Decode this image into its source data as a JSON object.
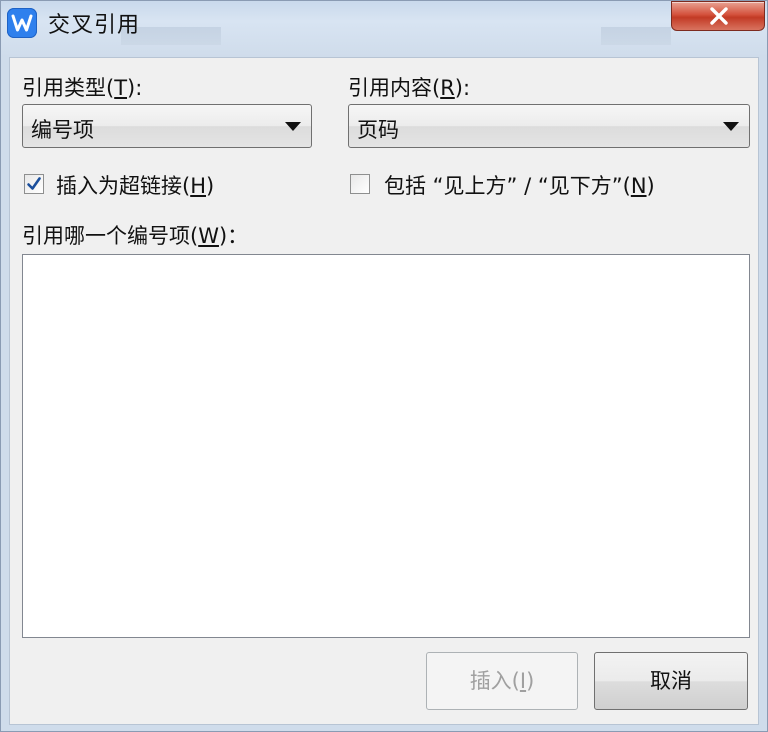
{
  "window": {
    "title": "交叉引用",
    "close_symbol": "✕"
  },
  "ref_type": {
    "label": "引用类型(",
    "mnemonic": "T",
    "label_end": "):",
    "selected": "编号项"
  },
  "ref_content": {
    "label": "引用内容(",
    "mnemonic": "R",
    "label_end": "):",
    "selected": "页码"
  },
  "hyperlink_option": {
    "label": "插入为超链接(",
    "mnemonic": "H",
    "label_end": ")",
    "checked": true
  },
  "above_below_option": {
    "label": "包括 “见上方” / “见下方”(",
    "mnemonic": "N",
    "label_end": ")",
    "checked": false
  },
  "which_item": {
    "label": "引用哪一个编号项(",
    "mnemonic": "W",
    "label_end": ")：",
    "items": []
  },
  "buttons": {
    "insert": "插入(",
    "insert_mnemonic": "I",
    "insert_end": ")",
    "cancel": "取消"
  },
  "colors": {
    "app_icon": "#2f80ed",
    "close_button": "#c23a25",
    "check_mark": "#1b4f9c"
  }
}
